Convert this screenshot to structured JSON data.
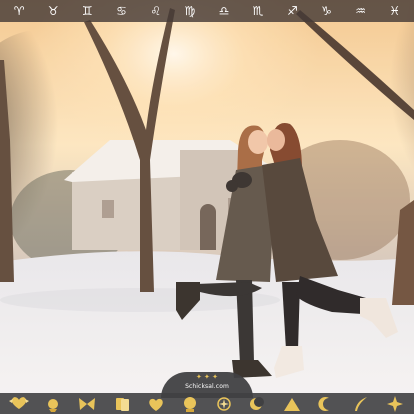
{
  "zodiac_nav": [
    {
      "glyph": "♈",
      "icon": "aries-icon"
    },
    {
      "glyph": "♉",
      "icon": "taurus-icon"
    },
    {
      "glyph": "♊",
      "icon": "gemini-icon"
    },
    {
      "glyph": "♋",
      "icon": "cancer-icon"
    },
    {
      "glyph": "♌",
      "icon": "leo-icon"
    },
    {
      "glyph": "♍",
      "icon": "virgo-icon"
    },
    {
      "glyph": "♎",
      "icon": "libra-icon"
    },
    {
      "glyph": "♏",
      "icon": "scorpio-icon"
    },
    {
      "glyph": "♐",
      "icon": "sagittarius-icon"
    },
    {
      "glyph": "♑",
      "icon": "capricorn-icon"
    },
    {
      "glyph": "♒",
      "icon": "aquarius-icon"
    },
    {
      "glyph": "♓",
      "icon": "pisces-icon"
    }
  ],
  "brand": {
    "logo_text": "Schicksal.com",
    "accent_color": "#e9c45a",
    "bar_color": "#404042"
  },
  "bottom_nav": [
    {
      "icon": "heart-wings-icon"
    },
    {
      "icon": "rooster-icon"
    },
    {
      "icon": "butterfly-icon"
    },
    {
      "icon": "cards-icon"
    },
    {
      "icon": "heart-shield-icon"
    },
    {
      "icon": "crystal-ball-icon"
    },
    {
      "icon": "sparkle-star-icon"
    },
    {
      "icon": "moon-sun-icon"
    },
    {
      "icon": "pyramid-icon"
    },
    {
      "icon": "crescent-moon-icon"
    },
    {
      "icon": "feather-icon"
    },
    {
      "icon": "star-burst-icon"
    }
  ]
}
